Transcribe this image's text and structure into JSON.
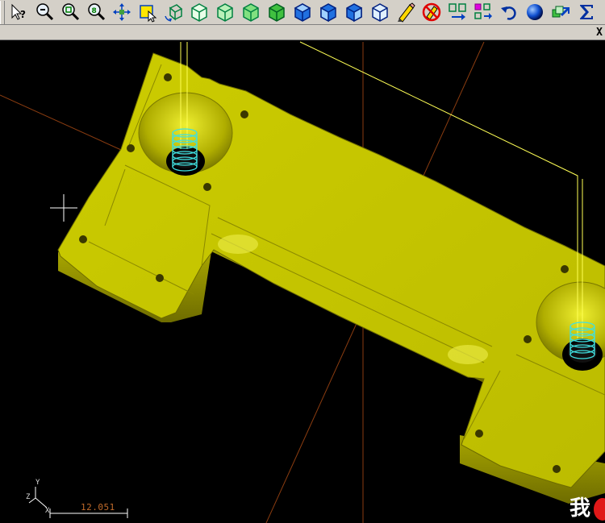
{
  "toolbar": {
    "buttons": [
      {
        "name": "select-help-icon"
      },
      {
        "name": "zoom-out-icon"
      },
      {
        "name": "zoom-window-icon"
      },
      {
        "name": "zoom-fit-icon"
      },
      {
        "name": "pan-icon"
      },
      {
        "name": "edit-select-icon"
      },
      {
        "name": "rotate-view-icon"
      },
      {
        "name": "view-cube-1-icon"
      },
      {
        "name": "view-cube-2-icon"
      },
      {
        "name": "view-cube-3-icon"
      },
      {
        "name": "view-cube-4-icon"
      },
      {
        "name": "view-cube-iso-1-icon"
      },
      {
        "name": "view-cube-iso-2-icon"
      },
      {
        "name": "view-cube-iso-3-icon"
      },
      {
        "name": "view-cube-iso-4-icon"
      },
      {
        "name": "eraser-pencil-icon"
      },
      {
        "name": "no-erase-icon"
      },
      {
        "name": "transform-icon"
      },
      {
        "name": "layout-icon"
      },
      {
        "name": "undo-icon"
      },
      {
        "name": "shade-sphere-icon"
      },
      {
        "name": "stack-icon"
      },
      {
        "name": "sum-icon"
      }
    ]
  },
  "strip": {
    "close_label": "X"
  },
  "viewport": {
    "scale_value": "12.051",
    "axis": {
      "y": "Y",
      "z": "Z",
      "x": "X"
    },
    "watermark_text": "我"
  },
  "colors": {
    "part": "#c8c800",
    "part_shadow": "#8c8a00",
    "toolpath": "#ffff55",
    "coil": "#40e0e0",
    "axis_line": "#a04a10",
    "background": "#000000"
  }
}
